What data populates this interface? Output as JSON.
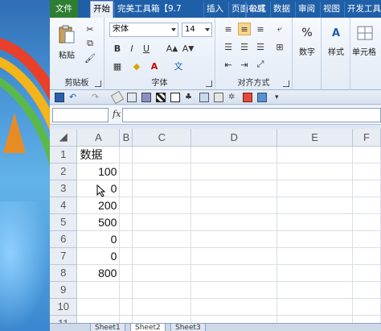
{
  "ribbon_tabs": [
    "文件",
    "开始",
    "完美工具箱【9.7",
    "插入",
    "页面布局",
    "公式",
    "数据",
    "审阅",
    "视图",
    "开发工具"
  ],
  "clipboard": {
    "paste_label": "粘贴",
    "group_label": "剪贴板"
  },
  "font": {
    "name": "宋体",
    "size": "14",
    "group_label": "字体"
  },
  "alignment": {
    "group_label": "对齐方式"
  },
  "number": {
    "label": "数字"
  },
  "styles": {
    "label": "样式"
  },
  "cells": {
    "label": "单元格"
  },
  "formula_bar": {
    "fx_label": "fx",
    "name_box_value": "",
    "formula_value": ""
  },
  "columns": [
    "A",
    "B",
    "C",
    "D",
    "E",
    "F"
  ],
  "rows": [
    {
      "row": "1",
      "a": "数据"
    },
    {
      "row": "2",
      "a": "100"
    },
    {
      "row": "3",
      "a": "0"
    },
    {
      "row": "4",
      "a": "200"
    },
    {
      "row": "5",
      "a": "500"
    },
    {
      "row": "6",
      "a": "0"
    },
    {
      "row": "7",
      "a": "0"
    },
    {
      "row": "8",
      "a": "800"
    },
    {
      "row": "9",
      "a": ""
    },
    {
      "row": "10",
      "a": ""
    },
    {
      "row": "11",
      "a": ""
    }
  ],
  "sheet_tabs": [
    "Sheet1",
    "Sheet2",
    "Sheet3"
  ],
  "colors": {
    "ribbon_tab_bar": "#1f5fa8",
    "file_tab": "#2e7d32",
    "header_bg": "#e8edf4",
    "selected_header": "#f7d58b"
  }
}
